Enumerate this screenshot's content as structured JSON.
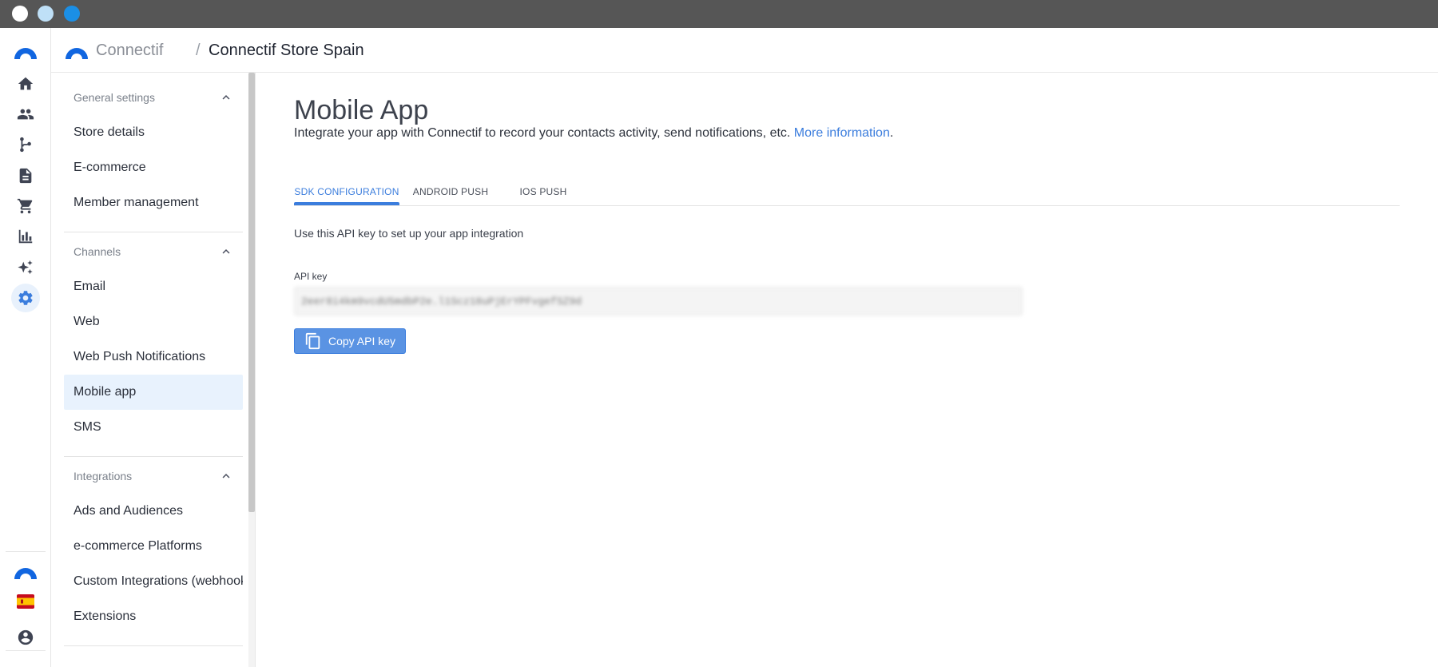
{
  "window": {
    "dots": [
      "close",
      "minimize",
      "maximize"
    ]
  },
  "rail": {
    "items": [
      {
        "name": "home-icon",
        "active": false
      },
      {
        "name": "contacts-icon",
        "active": false
      },
      {
        "name": "workflow-icon",
        "active": false
      },
      {
        "name": "content-icon",
        "active": false
      },
      {
        "name": "cart-icon",
        "active": false
      },
      {
        "name": "analytics-icon",
        "active": false
      },
      {
        "name": "ai-sparkle-icon",
        "active": false
      },
      {
        "name": "settings-gear-icon",
        "active": true
      }
    ],
    "bottom": [
      "connectif-logo-icon",
      "spain-flag-icon",
      "account-icon"
    ]
  },
  "header": {
    "brand": "Connectif",
    "separator": "/",
    "store": "Connectif Store Spain"
  },
  "sidebar": {
    "sections": [
      {
        "title": "General settings",
        "items": [
          "Store details",
          "E-commerce",
          "Member management"
        ]
      },
      {
        "title": "Channels",
        "items": [
          "Email",
          "Web",
          "Web Push Notifications",
          "Mobile app",
          "SMS"
        ]
      },
      {
        "title": "Integrations",
        "items": [
          "Ads and Audiences",
          "e-commerce Platforms",
          "Custom Integrations (webhooks)",
          "Extensions"
        ]
      }
    ],
    "active_item": "Mobile app"
  },
  "main": {
    "title": "Mobile App",
    "description": "Integrate your app with Connectif to record your contacts activity, send notifications, etc. ",
    "more_link": "More information",
    "description_end": ".",
    "tabs": [
      {
        "label": "SDK CONFIGURATION",
        "active": true
      },
      {
        "label": "ANDROID PUSH",
        "active": false
      },
      {
        "label": "IOS PUSH",
        "active": false
      }
    ],
    "helper_text": "Use this API key to set up your app integration",
    "api_key_label": "API key",
    "api_key_value": "2eer8i4km9vcdU5mdbP2e.l1Scz18uPjErYPFvgefSZ9d",
    "copy_button": "Copy API key"
  },
  "colors": {
    "accent": "#3b7ddd",
    "titlebar": "#565656",
    "active_bg": "#e8f2fd"
  }
}
